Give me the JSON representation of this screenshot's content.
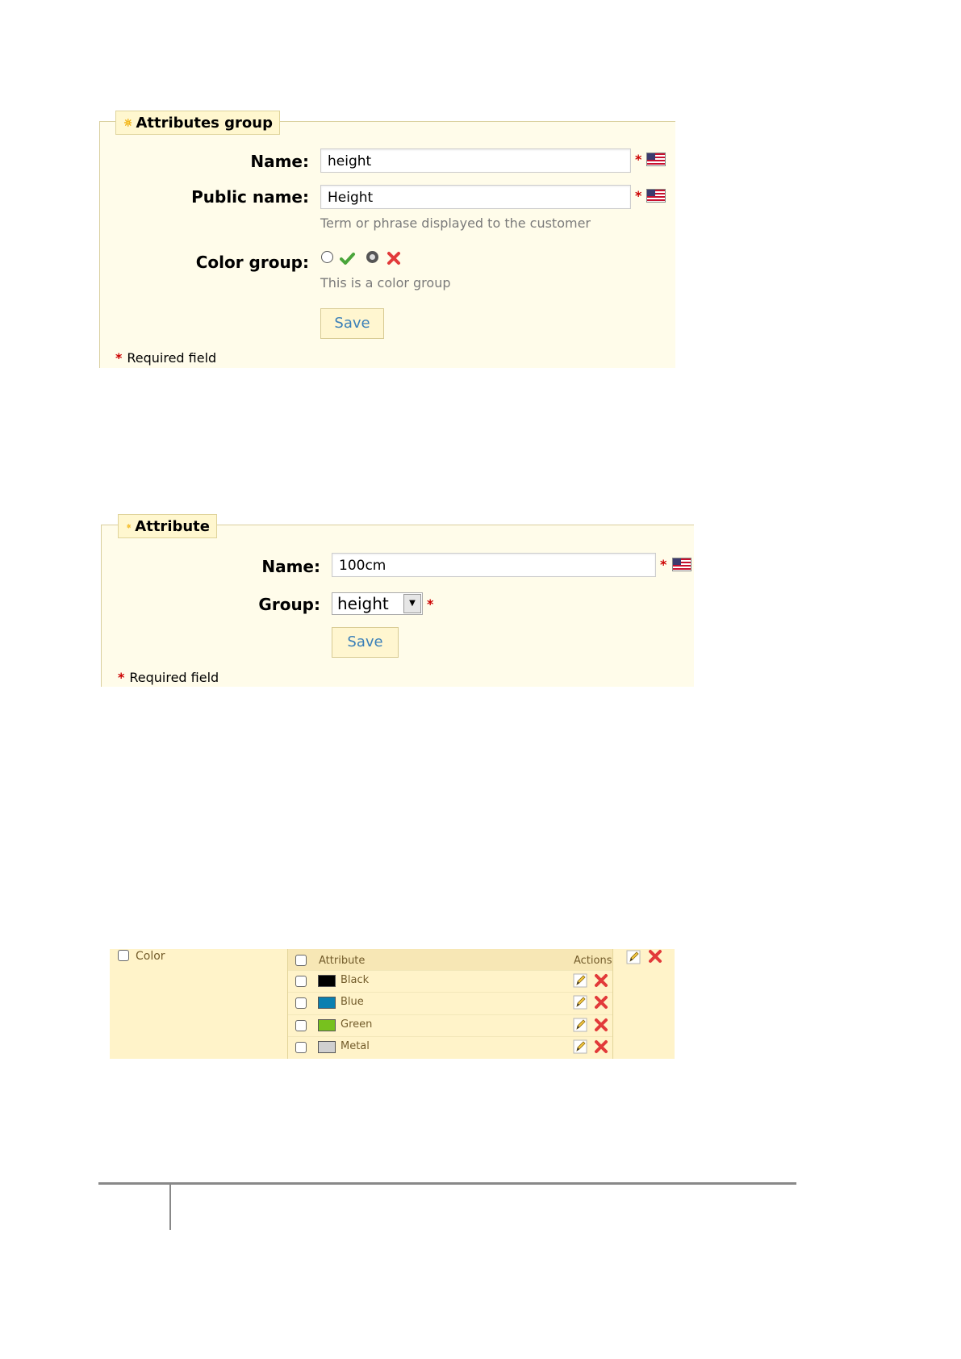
{
  "attributes_group_panel": {
    "title": "Attributes group",
    "name_label": "Name:",
    "name_value": "height",
    "public_name_label": "Public name:",
    "public_name_value": "Height",
    "public_name_hint": "Term or phrase displayed to the customer",
    "color_group_label": "Color group:",
    "color_group_selected": "no",
    "color_group_hint": "This is a color group",
    "save_label": "Save",
    "required_star": "*",
    "required_text": "Required field"
  },
  "attribute_panel": {
    "title": "Attribute",
    "name_label": "Name:",
    "name_value": "100cm",
    "group_label": "Group:",
    "group_value": "height",
    "save_label": "Save",
    "required_star": "*",
    "required_text": "Required field"
  },
  "attribute_list": {
    "group_name": "Color",
    "header_attribute": "Attribute",
    "header_actions": "Actions",
    "rows": [
      {
        "name": "Black",
        "color": "#000000"
      },
      {
        "name": "Blue",
        "color": "#0a7fb0"
      },
      {
        "name": "Green",
        "color": "#77c11e"
      },
      {
        "name": "Metal",
        "color": "#d0d0d0"
      }
    ]
  },
  "colors": {
    "panel_bg": "#fffcea",
    "list_bg": "#fff3c9",
    "required": "#cc0000",
    "link": "#3a7fb8"
  }
}
